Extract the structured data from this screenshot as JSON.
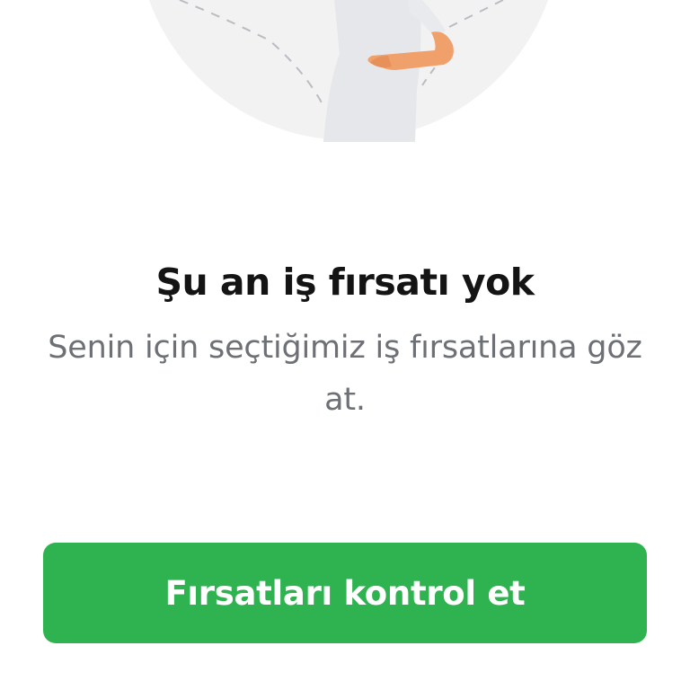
{
  "empty_state": {
    "title": "Şu an iş fırsatı yok",
    "subtitle": "Senin için seçtiğimiz iş fırsatlarına göz at.",
    "illustration_icon": "person-illustration-icon"
  },
  "actions": {
    "check_opportunities_label": "Fırsatları kontrol et"
  },
  "colors": {
    "primary_button": "#2fb350",
    "title_text": "#141414",
    "subtitle_text": "#6d7176",
    "illustration_circle": "#f2f2f3",
    "skin": "#f0a06a"
  }
}
